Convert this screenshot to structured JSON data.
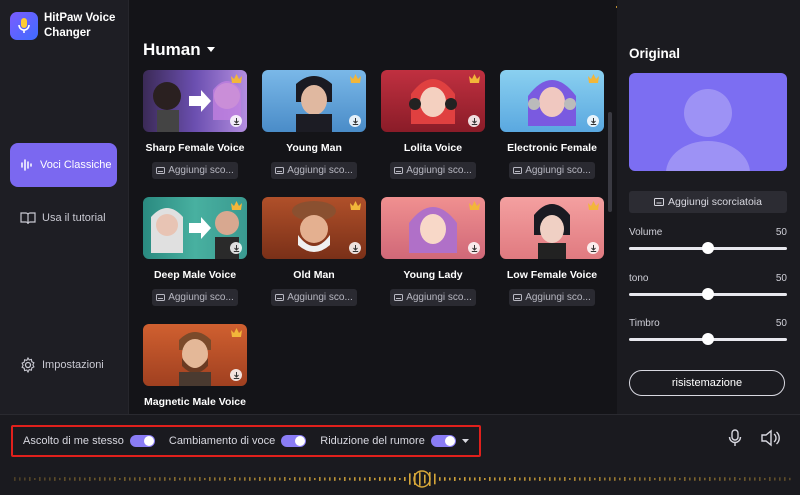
{
  "app": {
    "name": "HitPaw Voice Changer"
  },
  "sidebar": {
    "items": [
      {
        "label": "Voci Classiche",
        "icon": "voice-wave-icon",
        "active": true
      },
      {
        "label": "Usa il tutorial",
        "icon": "book-icon",
        "active": false
      }
    ],
    "settings_label": "Impostazioni"
  },
  "topbar": {
    "icons": [
      "cart-icon",
      "user-icon",
      "menu-icon",
      "minimize-icon",
      "close-icon"
    ]
  },
  "main": {
    "category": "Human",
    "add_shortcut_label": "Aggiungi sco...",
    "voices": [
      {
        "name": "Sharp Female Voice"
      },
      {
        "name": "Young Man"
      },
      {
        "name": "Lolita Voice"
      },
      {
        "name": "Electronic Female"
      },
      {
        "name": "Deep Male Voice"
      },
      {
        "name": "Old Man"
      },
      {
        "name": "Young Lady"
      },
      {
        "name": "Low Female Voice"
      },
      {
        "name": "Magnetic Male Voice"
      }
    ]
  },
  "right": {
    "title": "Original",
    "shortcut_label": "Aggiungi scorciatoia",
    "sliders": [
      {
        "label": "Volume",
        "value": "50"
      },
      {
        "label": "tono",
        "value": "50"
      },
      {
        "label": "Timbro",
        "value": "50"
      }
    ],
    "reset_label": "risistemazione"
  },
  "bottom": {
    "controls": [
      {
        "label": "Ascolto di me stesso",
        "on": true
      },
      {
        "label": "Cambiamento di voce",
        "on": true
      },
      {
        "label": "Riduzione del rumore",
        "on": true
      }
    ]
  },
  "colors": {
    "accent": "#7b68f0",
    "highlight": "#e0201c",
    "crown": "#f2b63a",
    "wave": "#d9a93a"
  }
}
